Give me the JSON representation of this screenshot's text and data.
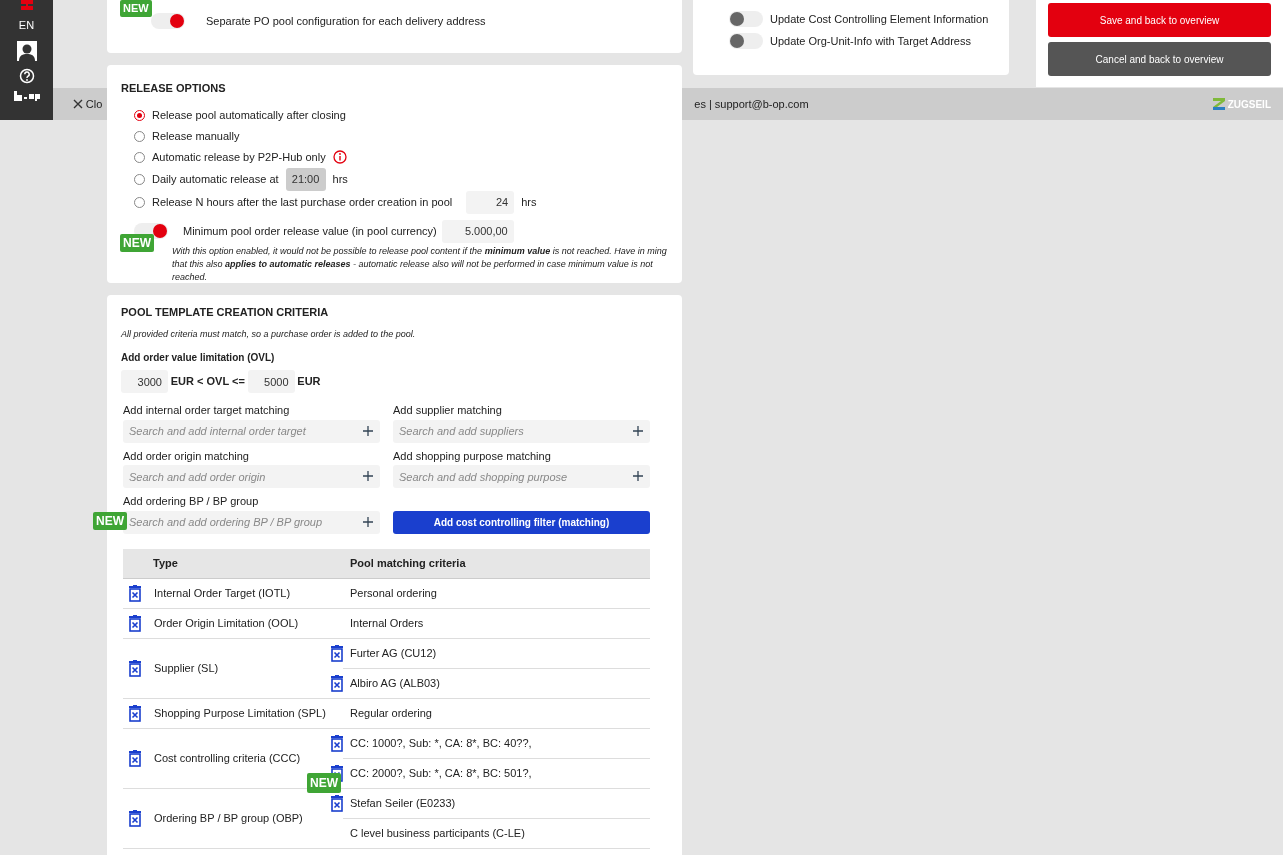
{
  "sidebar": {
    "language": "EN"
  },
  "footer": {
    "close_label": "Clo",
    "contact": "es | support@b-op.com",
    "brand": "ZUGSEIL"
  },
  "delivery_card": {
    "new_badge": "NEW",
    "toggles": [
      {
        "label": "Separate PO pool configuration for each delivery address",
        "on": true
      }
    ]
  },
  "update_card": {
    "toggles": [
      {
        "label": "Update Cost Controlling Element Information",
        "on": false
      },
      {
        "label": "Update Org-Unit-Info with Target Address",
        "on": false
      }
    ]
  },
  "actions": [
    {
      "label": "Save and back to overview",
      "kind": "primary"
    },
    {
      "label": "Cancel and back to overview",
      "kind": "secondary"
    }
  ],
  "release_options": {
    "title": "RELEASE OPTIONS",
    "options": [
      {
        "label": "Release pool automatically after closing",
        "selected": true
      },
      {
        "label": "Release manually",
        "selected": false
      },
      {
        "label": "Automatic release by P2P-Hub only",
        "selected": false,
        "info": true
      },
      {
        "label": "Daily automatic release at",
        "selected": false,
        "value": "21:00",
        "unit": "hrs",
        "disabled": true
      },
      {
        "label": "Release N hours after the last purchase order creation in pool",
        "selected": false,
        "value": "24",
        "unit": "hrs",
        "disabled": false
      }
    ],
    "minimum": {
      "on": true,
      "label": "Minimum pool order release value (in pool currency)",
      "value": "5.000,00",
      "new_badge": "NEW",
      "note": "With this option enabled, it would not be possible to release pool content if the **minimum value** is not reached. Have in ming that this also **applies to automatic releases** - automatic release also will not be performed in case minimum value is not reached."
    }
  },
  "criteria": {
    "title": "POOL TEMPLATE CREATION CRITERIA",
    "hint": "All provided criteria must match, so a purchase order is added to the pool.",
    "ovl": {
      "label": "Add order value limitation (OVL)",
      "min": "3000",
      "middle": "EUR < OVL <=",
      "max": "5000",
      "unit": "EUR"
    },
    "matchers": [
      {
        "label": "Add internal order target matching",
        "placeholder": "Search and add internal order target"
      },
      {
        "label": "Add supplier matching",
        "placeholder": "Search and add suppliers"
      },
      {
        "label": "Add order origin matching",
        "placeholder": "Search and add order origin"
      },
      {
        "label": "Add shopping purpose matching",
        "placeholder": "Search and add shopping purpose"
      },
      {
        "label": "Add ordering BP / BP group",
        "placeholder": "Search and add ordering BP / BP group",
        "new_badge": "NEW"
      }
    ],
    "filter_button": "Add cost controlling filter (matching)",
    "table": {
      "columns": [
        "Type",
        "Pool matching criteria"
      ],
      "new_badge": "NEW",
      "rows": [
        {
          "type": "Internal Order Target (IOTL)",
          "criteria": [
            {
              "text": "Personal ordering",
              "deletable": false
            }
          ]
        },
        {
          "type": "Order Origin Limitation (OOL)",
          "criteria": [
            {
              "text": "Internal Orders",
              "deletable": false
            }
          ]
        },
        {
          "type": "Supplier (SL)",
          "criteria": [
            {
              "text": "Furter AG (CU12)",
              "deletable": true
            },
            {
              "text": "Albiro AG (ALB03)",
              "deletable": true
            }
          ]
        },
        {
          "type": "Shopping Purpose Limitation (SPL)",
          "criteria": [
            {
              "text": "Regular ordering",
              "deletable": false
            }
          ]
        },
        {
          "type": "Cost controlling criteria (CCC)",
          "criteria": [
            {
              "text": "CC: 1000?, Sub: *, CA: 8*, BC: 40??,",
              "deletable": true
            },
            {
              "text": "CC: 2000?, Sub: *, CA: 8*, BC: 501?,",
              "deletable": true
            }
          ]
        },
        {
          "type": "Ordering BP / BP group (OBP)",
          "criteria": [
            {
              "text": "Stefan Seiler (E0233)",
              "deletable": true
            },
            {
              "text": "C level business participants (C-LE)",
              "deletable": false
            }
          ]
        }
      ]
    }
  }
}
